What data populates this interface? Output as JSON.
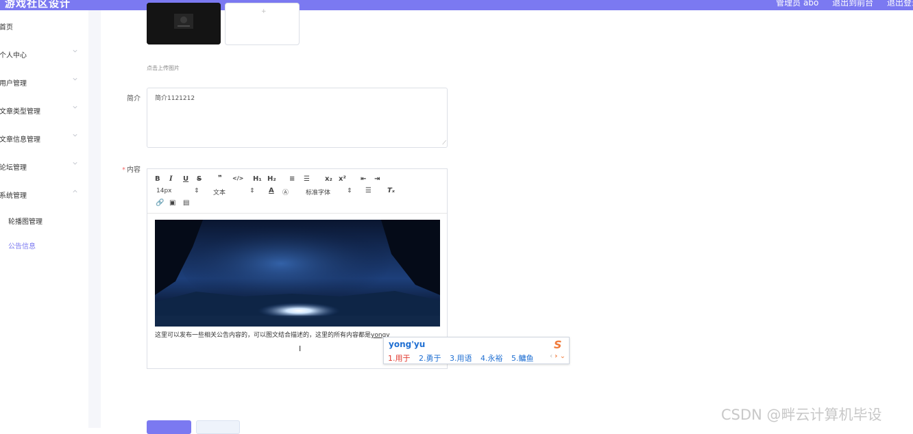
{
  "header": {
    "app_title": "游戏社区设计",
    "user_label": "管理员 abo",
    "back_label": "退出到前台",
    "logout_label": "退出登录"
  },
  "sidebar": {
    "items": [
      {
        "label": "首页"
      },
      {
        "label": "个人中心"
      },
      {
        "label": "用户管理"
      },
      {
        "label": "文章类型管理"
      },
      {
        "label": "文章信息管理"
      },
      {
        "label": "论坛管理"
      },
      {
        "label": "系统管理"
      }
    ],
    "sub_items": [
      {
        "label": "轮播图管理"
      },
      {
        "label": "公告信息"
      }
    ]
  },
  "form": {
    "upload_hint": "点击上传图片",
    "intro_label": "简介",
    "intro_value": "简介1121212",
    "content_label": "内容",
    "content_text": "这里可以发布一些相关公告内容的，可以图文结合描述的，这里的所有内容都是",
    "content_typed": "yongy"
  },
  "toolbar": {
    "font_size": "14px",
    "block_type": "文本",
    "font_family": "标准字体"
  },
  "ime": {
    "pinyin": "yong'yu",
    "candidates": [
      "1.用于",
      "2.勇于",
      "3.用语",
      "4.永裕",
      "5.鳙鱼"
    ]
  },
  "watermark": "CSDN @畔云计算机毕设",
  "colors": {
    "accent": "#7b79f1",
    "required": "#f56c6c"
  }
}
